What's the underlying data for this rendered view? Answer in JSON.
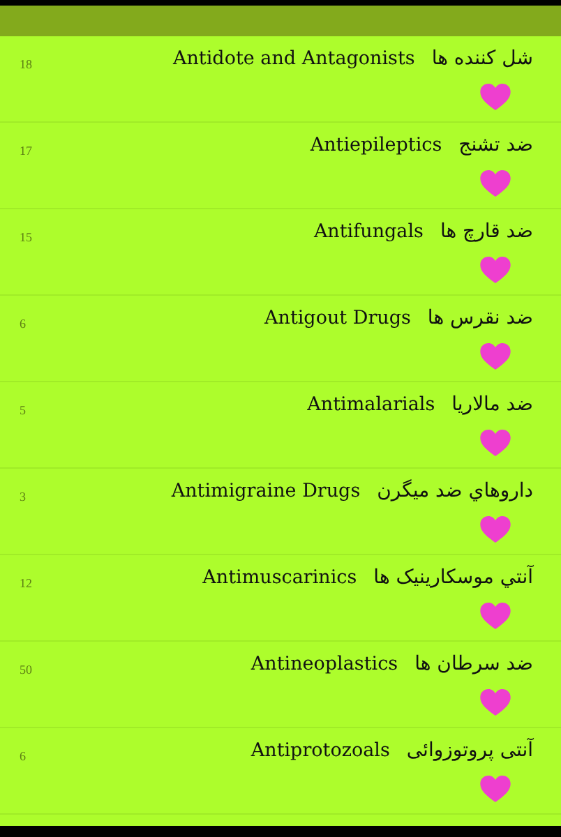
{
  "items": [
    {
      "count": "18",
      "name_en": "Antidote and Antagonists",
      "name_fa": "شل کننده ها"
    },
    {
      "count": "17",
      "name_en": "Antiepileptics",
      "name_fa": "ضد تشنج"
    },
    {
      "count": "15",
      "name_en": "Antifungals",
      "name_fa": "ضد قارچ ها"
    },
    {
      "count": "6",
      "name_en": "Antigout Drugs",
      "name_fa": "ضد نقرس ها"
    },
    {
      "count": "5",
      "name_en": "Antimalarials",
      "name_fa": "ضد مالاريا"
    },
    {
      "count": "3",
      "name_en": "Antimigraine Drugs",
      "name_fa": "داروهاي ضد ميگرن"
    },
    {
      "count": "12",
      "name_en": "Antimuscarinics",
      "name_fa": "آنتي موسکارينيک ها"
    },
    {
      "count": "50",
      "name_en": "Antineoplastics",
      "name_fa": "ضد سرطان ها"
    },
    {
      "count": "6",
      "name_en": "Antiprotozoals",
      "name_fa": "آنتی پروتوزوائی"
    }
  ]
}
